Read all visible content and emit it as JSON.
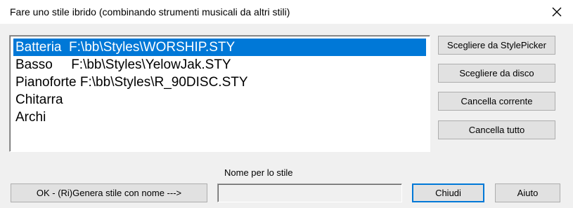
{
  "window": {
    "title": "Fare uno stile ibrido (combinando strumenti musicali da altri stili)",
    "close_icon": "close-icon"
  },
  "instrument_list": {
    "items": [
      {
        "label": "Batteria  F:\\bb\\Styles\\WORSHIP.STY",
        "selected": true
      },
      {
        "label": "Basso     F:\\bb\\Styles\\YelowJak.STY",
        "selected": false
      },
      {
        "label": "Pianoforte F:\\bb\\Styles\\R_90DISC.STY",
        "selected": false
      },
      {
        "label": "Chitarra",
        "selected": false
      },
      {
        "label": "Archi",
        "selected": false
      }
    ]
  },
  "side_buttons": {
    "stylepicker": "Scegliere da StylePicker",
    "disk": "Scegliere da disco",
    "clear_current": "Cancella corrente",
    "clear_all": "Cancella tutto"
  },
  "bottom": {
    "ok_button": "OK - (Ri)Genera stile con nome --->",
    "name_label": "Nome per lo stile",
    "name_value": "",
    "close_button": "Chiudi",
    "help_button": "Aiuto"
  },
  "colors": {
    "selection": "#0078d7",
    "default_button_border": "#0078d7"
  }
}
